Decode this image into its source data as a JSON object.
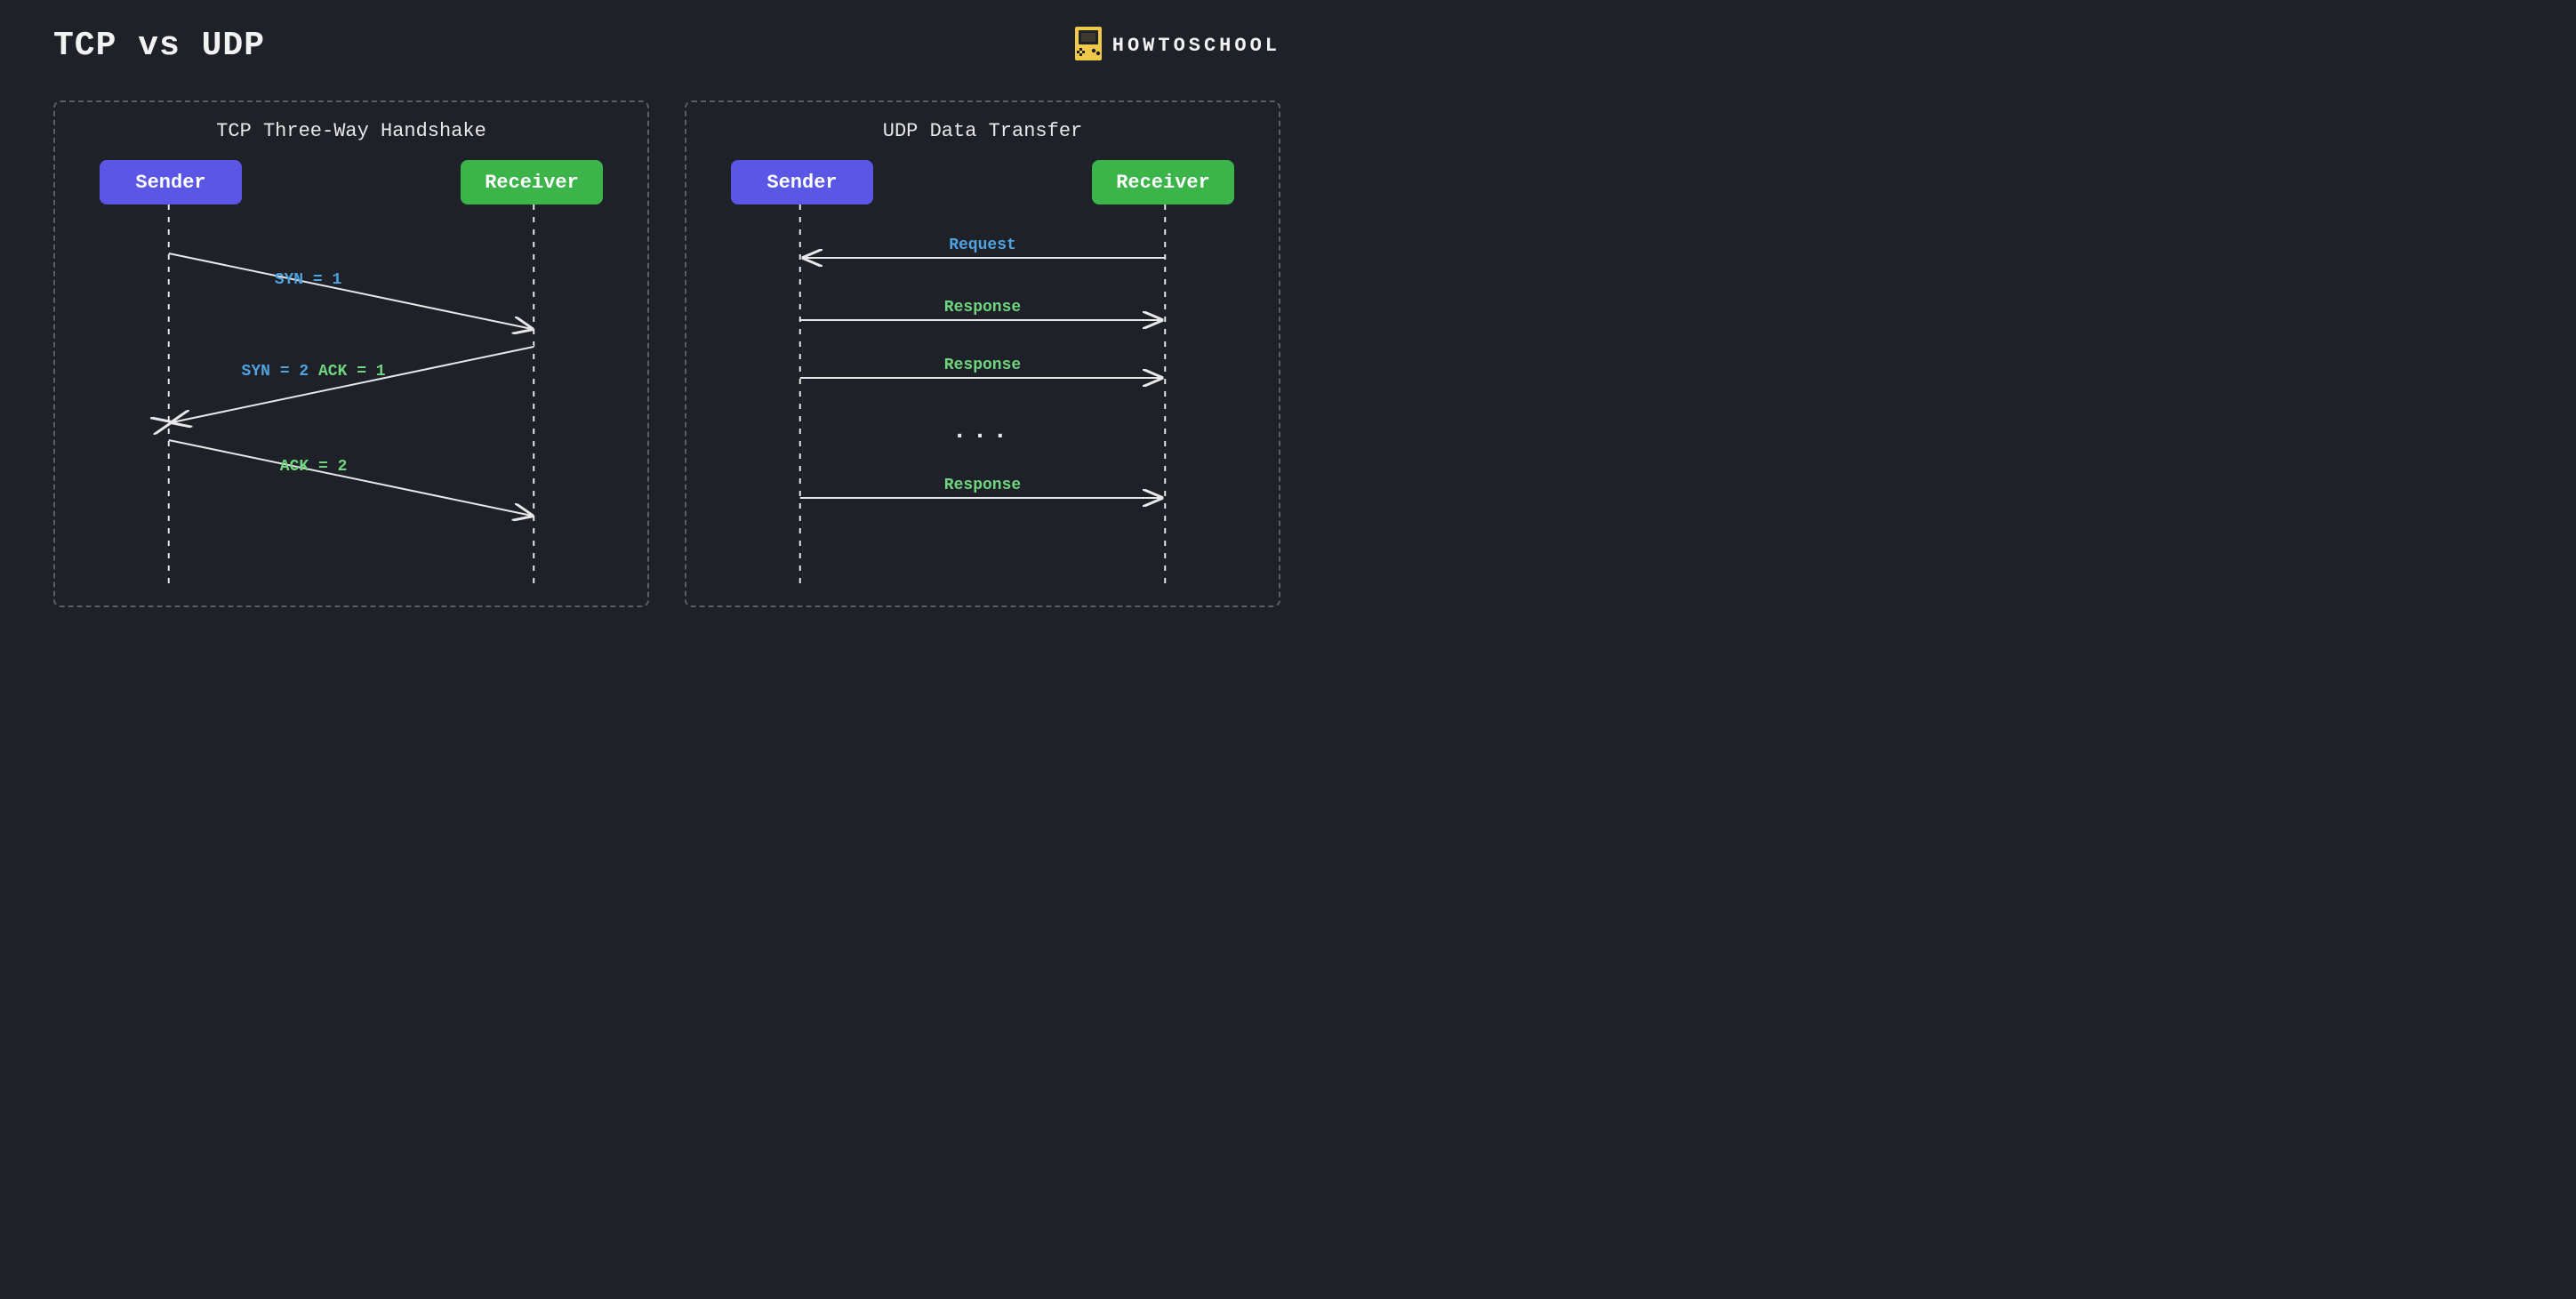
{
  "title": "TCP vs UDP",
  "brand": "HOWTOSCHOOL",
  "panels": {
    "tcp": {
      "title": "TCP Three-Way Handshake",
      "sender": "Sender",
      "receiver": "Receiver",
      "messages": {
        "m1": "SYN = 1",
        "m2_a": "SYN = 2",
        "m2_b": " ACK = 1",
        "m3": "ACK = 2"
      }
    },
    "udp": {
      "title": "UDP Data Transfer",
      "sender": "Sender",
      "receiver": "Receiver",
      "messages": {
        "req": "Request",
        "resp1": "Response",
        "resp2": "Response",
        "dots": "...",
        "resp3": "Response"
      }
    }
  }
}
